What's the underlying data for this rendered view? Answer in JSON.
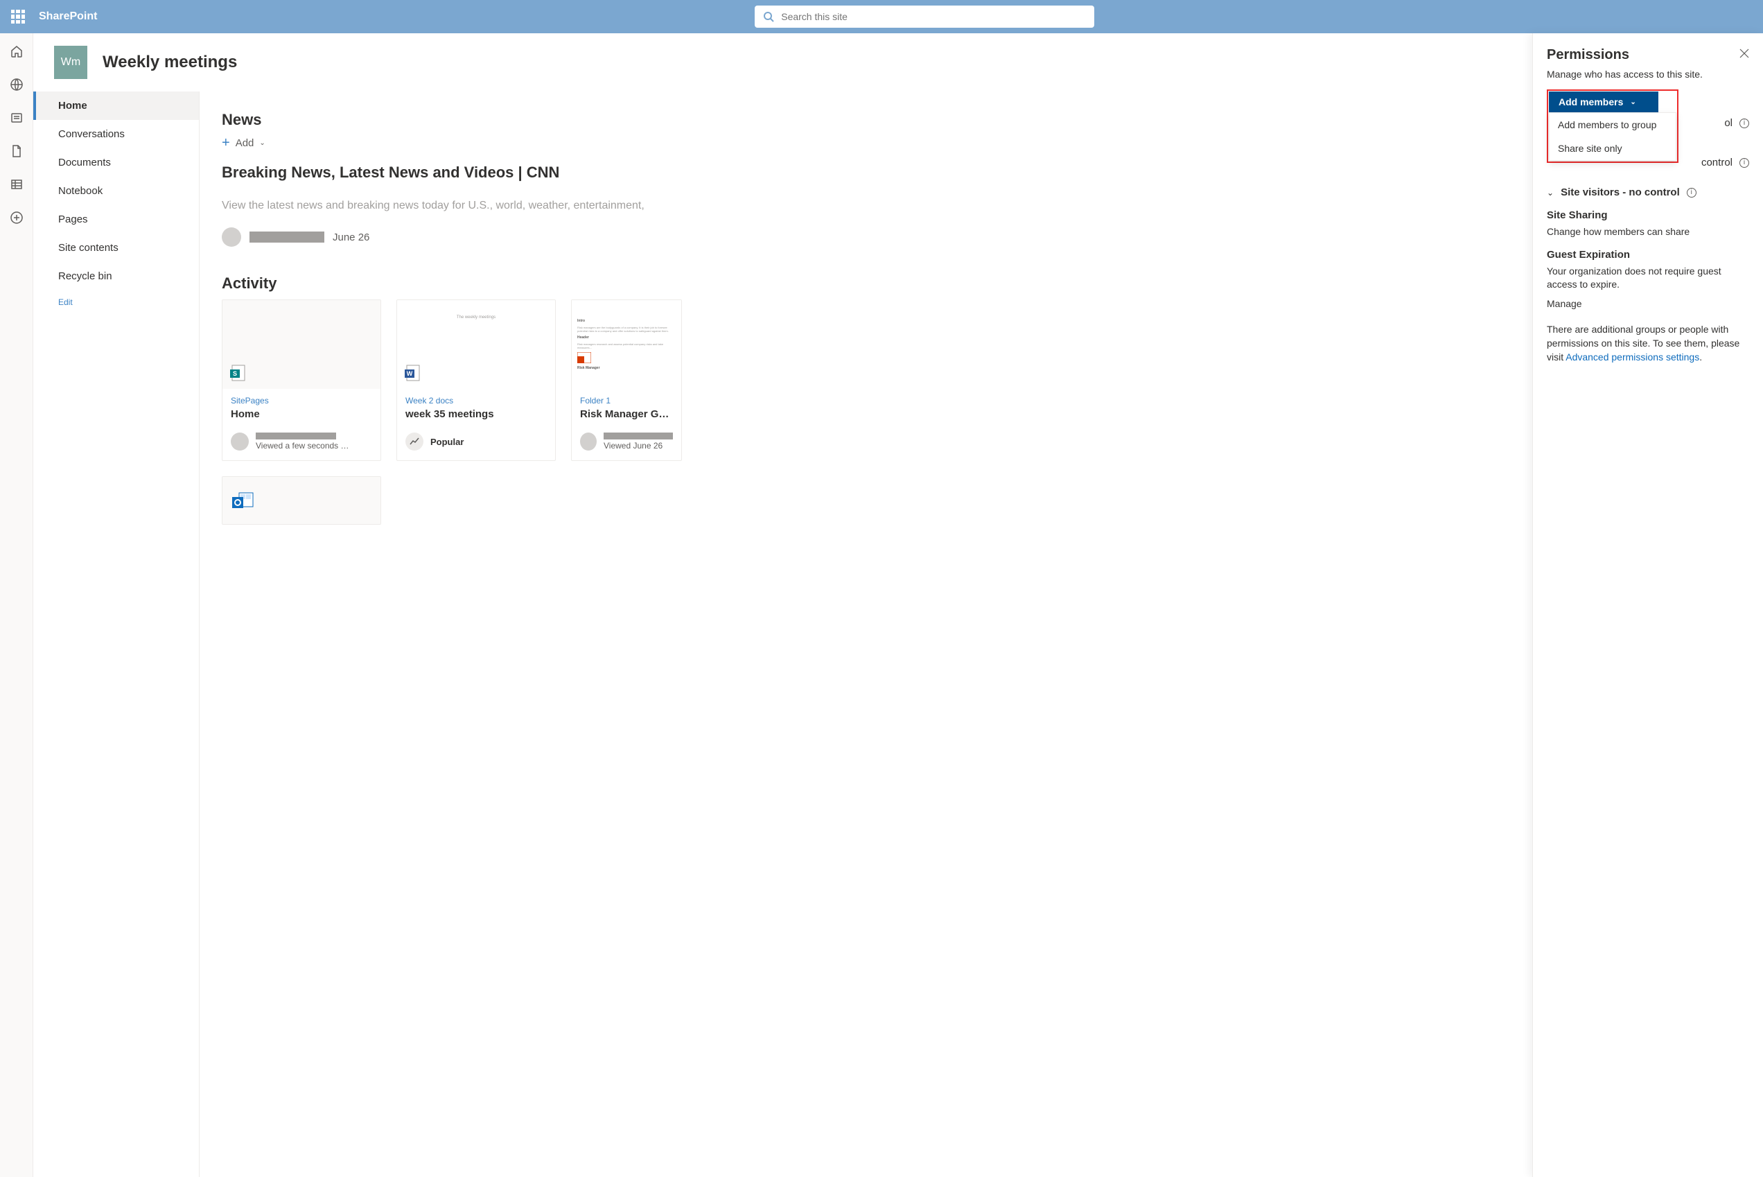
{
  "topbar": {
    "brand": "SharePoint",
    "search_placeholder": "Search this site"
  },
  "site": {
    "logo_text": "Wm",
    "title": "Weekly meetings"
  },
  "leftnav": {
    "items": [
      "Home",
      "Conversations",
      "Documents",
      "Notebook",
      "Pages",
      "Site contents",
      "Recycle bin"
    ],
    "edit": "Edit"
  },
  "news": {
    "heading": "News",
    "add": "Add",
    "title": "Breaking News, Latest News and Videos | CNN",
    "desc": "View the latest news and breaking news today for U.S., world, weather, entertainment, ",
    "date": "June 26"
  },
  "activity": {
    "heading": "Activity",
    "cards": [
      {
        "loc": "SitePages",
        "title": "Home",
        "footer": "Viewed a few seconds …"
      },
      {
        "loc": "Week 2 docs",
        "title": "week 35 meetings",
        "footer": "Popular"
      },
      {
        "loc": "Folder 1",
        "title": "Risk Manager Guide",
        "footer": "Viewed June 26"
      }
    ]
  },
  "panel": {
    "title": "Permissions",
    "subtitle": "Manage who has access to this site.",
    "add_members": "Add members",
    "dropdown": {
      "opt1": "Add members to group",
      "opt2": "Share site only"
    },
    "rows": {
      "row1_suffix": "ol",
      "row2": "control",
      "row3": "Site visitors - no control"
    },
    "sharing": {
      "heading": "Site Sharing",
      "link": "Change how members can share"
    },
    "guest": {
      "heading": "Guest Expiration",
      "text": "Your organization does not require guest access to expire.",
      "link": "Manage"
    },
    "advanced": {
      "text": "There are additional groups or people with permissions on this site. To see them, please visit ",
      "link": "Advanced permissions settings",
      "dot": "."
    }
  }
}
